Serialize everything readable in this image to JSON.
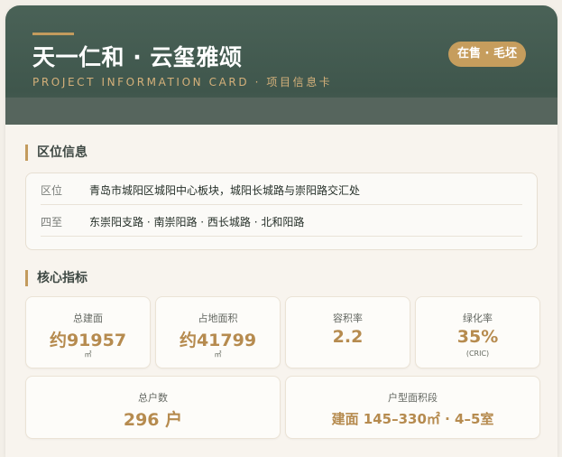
{
  "header": {
    "title": "天一仁和 · 云玺雅颂",
    "subtitle": "PROJECT INFORMATION CARD · 项目信息卡",
    "badge": "在售 · 毛坯"
  },
  "location": {
    "section_title": "区位信息",
    "rows": [
      {
        "label": "区位",
        "value": "青岛市城阳区城阳中心板块，城阳长城路与崇阳路交汇处"
      },
      {
        "label": "四至",
        "value": "东崇阳支路 · 南崇阳路 · 西长城路 · 北和阳路"
      }
    ]
  },
  "metrics": {
    "section_title": "核心指标",
    "cards": [
      {
        "label": "总建面",
        "value": "约91957",
        "unit": "㎡"
      },
      {
        "label": "占地面积",
        "value": "约41799",
        "unit": "㎡"
      },
      {
        "label": "容积率",
        "value": "2.2",
        "unit": ""
      },
      {
        "label": "绿化率",
        "value": "35%",
        "unit": "(CRIC)"
      },
      {
        "label": "总户数",
        "value": "296 户",
        "unit": ""
      },
      {
        "label": "户型面积段",
        "value": "建面 145–330㎡ · 4–5室",
        "unit": ""
      }
    ]
  }
}
